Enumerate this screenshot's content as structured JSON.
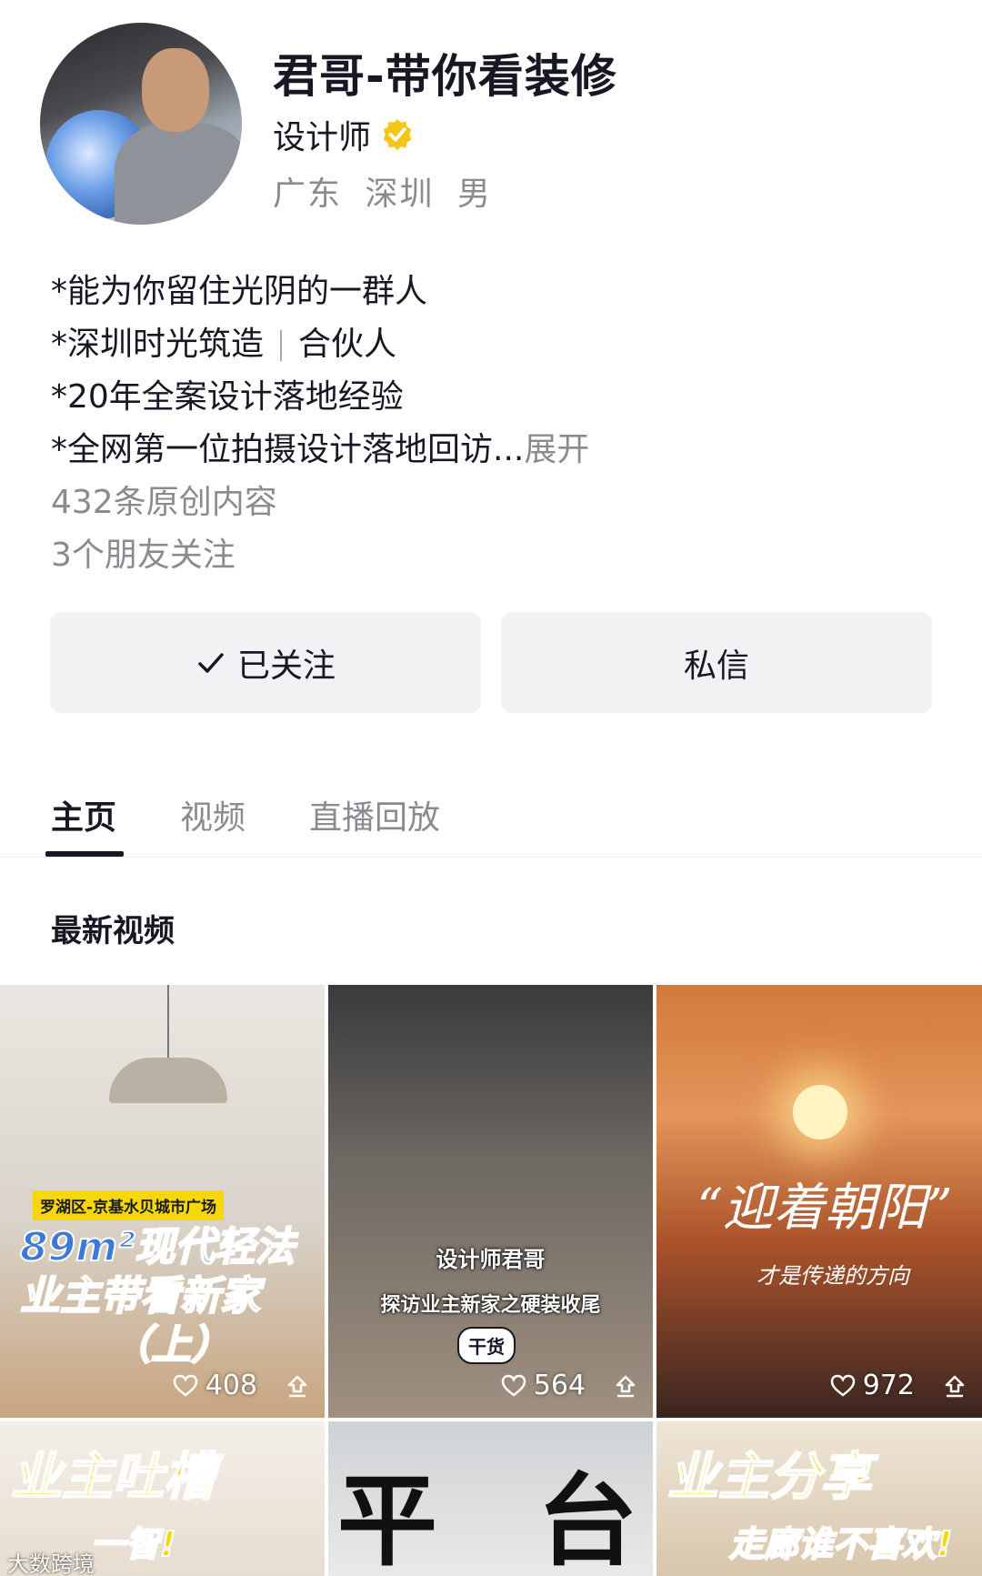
{
  "profile": {
    "name": "君哥-带你看装修",
    "role": "设计师",
    "location": [
      "广东",
      "深圳",
      "男"
    ],
    "bio": [
      "*能为你留住光阴的一群人",
      "*深圳时光筑造",
      "合伙人",
      "*20年全案设计落地经验",
      "*全网第一位拍摄设计落地回访..."
    ],
    "expand_label": "展开",
    "original_count": "432条原创内容",
    "friends_following": "3个朋友关注"
  },
  "actions": {
    "following_label": "已关注",
    "message_label": "私信"
  },
  "tabs": [
    {
      "label": "主页",
      "active": true
    },
    {
      "label": "视频",
      "active": false
    },
    {
      "label": "直播回放",
      "active": false
    }
  ],
  "section_title": "最新视频",
  "videos": [
    {
      "tag": "罗湖区-京基水贝城市广场",
      "cover_lines": [
        "89m²现代轻法",
        "业主带看新家",
        "（上）"
      ],
      "likes": "408"
    },
    {
      "cover_lines": [
        "设计师君哥",
        "探访业主新家之硬装收尾"
      ],
      "pill": "干货",
      "likes": "564"
    },
    {
      "cover_lines": [
        "“迎着朝阳”",
        "才是传递的方向"
      ],
      "likes": "972"
    },
    {
      "cover_lines": [
        "业主吐槽",
        "一智!"
      ]
    },
    {
      "cover_lines": [
        "平",
        "台"
      ]
    },
    {
      "cover_lines": [
        "业主分享",
        "走廊谁不喜欢!"
      ]
    }
  ],
  "watermark": "大数跨境",
  "colors": {
    "verified_badge": "#F5C518",
    "tab_underline": "#161823",
    "button_bg": "#F2F2F4",
    "secondary_text": "#8A8B91"
  }
}
